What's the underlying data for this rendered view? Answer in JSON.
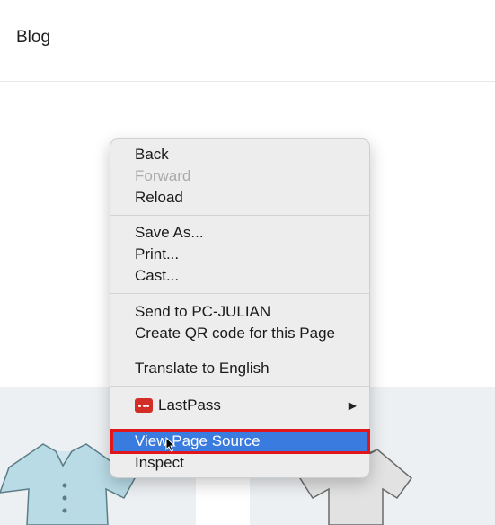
{
  "header": {
    "blog_label": "Blog"
  },
  "context_menu": {
    "items": [
      {
        "label": "Back",
        "enabled": true
      },
      {
        "label": "Forward",
        "enabled": false
      },
      {
        "label": "Reload",
        "enabled": true
      },
      {
        "label": "Save As...",
        "enabled": true
      },
      {
        "label": "Print...",
        "enabled": true
      },
      {
        "label": "Cast...",
        "enabled": true
      },
      {
        "label": "Send to PC-JULIAN",
        "enabled": true
      },
      {
        "label": "Create QR code for this Page",
        "enabled": true
      },
      {
        "label": "Translate to English",
        "enabled": true
      },
      {
        "label": "LastPass",
        "enabled": true,
        "icon": "lastpass-icon",
        "submenu": true
      },
      {
        "label": "View Page Source",
        "enabled": true,
        "highlighted": true
      },
      {
        "label": "Inspect",
        "enabled": true
      }
    ]
  },
  "colors": {
    "menu_background": "#ededed",
    "highlight_blue": "#3a7be0",
    "annotation_red": "#e0161b",
    "lastpass_red": "#d32d27"
  }
}
